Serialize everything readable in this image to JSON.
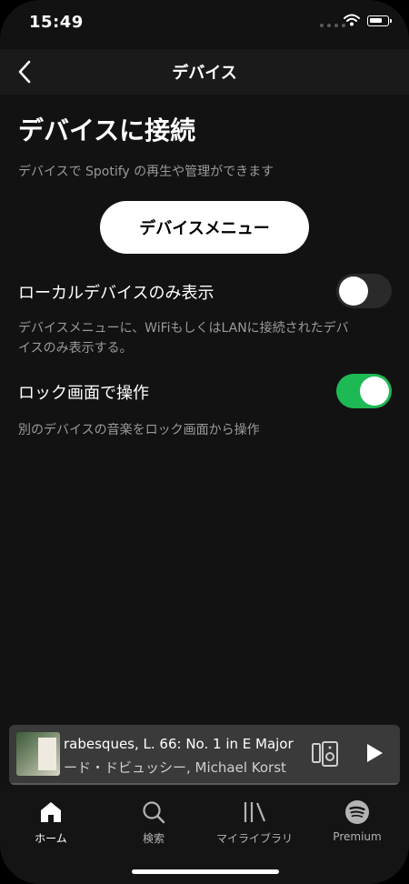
{
  "status_bar": {
    "time": "15:49"
  },
  "nav": {
    "title": "デバイス"
  },
  "content": {
    "heading": "デバイスに接続",
    "description": "デバイスで Spotify の再生や管理ができます",
    "device_menu_button": "デバイスメニュー",
    "local_only": {
      "label": "ローカルデバイスのみ表示",
      "help_line1": "デバイスメニューに、WiFiもしくはLANに接続されたデバ",
      "help_line2": "イスのみ表示する。",
      "enabled": false
    },
    "lock_screen": {
      "label": "ロック画面で操作",
      "help": "別のデバイスの音楽をロック画面から操作",
      "enabled": true
    }
  },
  "player": {
    "track": "rabesques, L. 66: No. 1 in E Major",
    "artist": "ード・ドビュッシー, Michael Korst",
    "progress": 0.0
  },
  "tabs": [
    {
      "label": "ホーム",
      "icon": "home-icon",
      "active": true
    },
    {
      "label": "検索",
      "icon": "search-icon",
      "active": false
    },
    {
      "label": "マイライブラリ",
      "icon": "library-icon",
      "active": false
    },
    {
      "label": "Premium",
      "icon": "spotify-icon",
      "active": false
    }
  ],
  "colors": {
    "accent": "#1db954",
    "background": "#121212"
  }
}
